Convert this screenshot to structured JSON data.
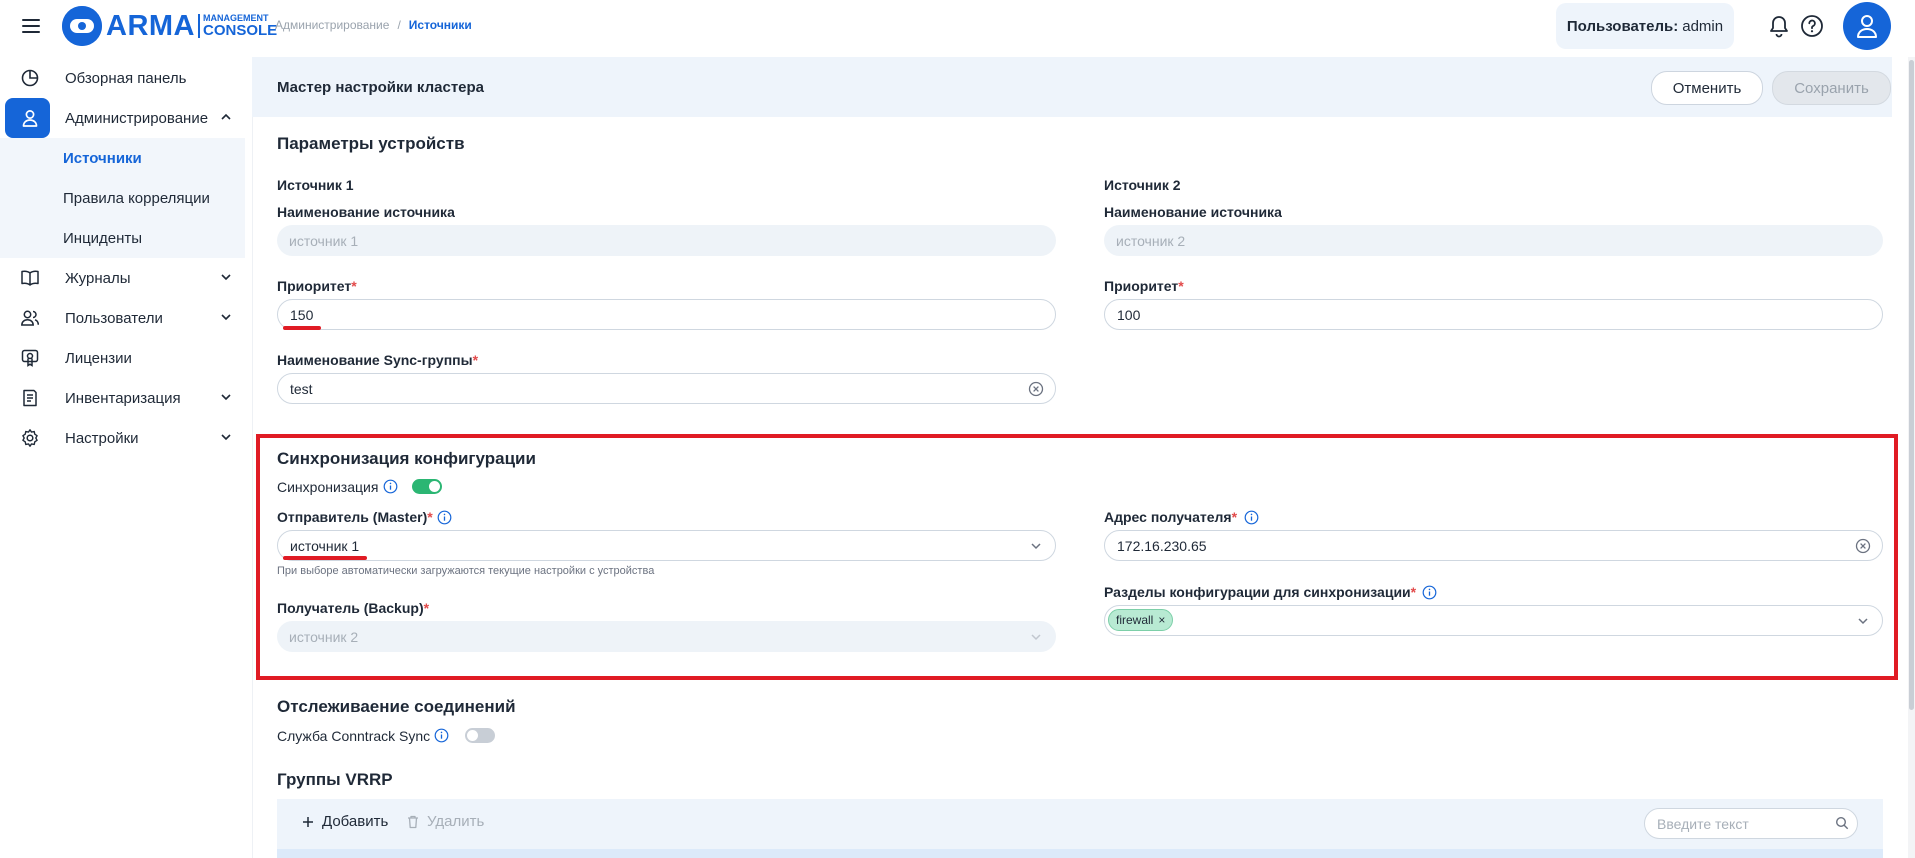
{
  "header": {
    "logo_text": "ARMA",
    "logo_sub1": "MANAGEMENT",
    "logo_sub2": "CONSOLE",
    "breadcrumb": [
      "Администрирование",
      "Источники"
    ],
    "user_label": "Пользователь:",
    "user_name": "admin"
  },
  "sidebar": {
    "items": [
      {
        "label": "Обзорная панель",
        "icon": "dashboard-icon"
      },
      {
        "label": "Администрирование",
        "icon": "user-icon",
        "expanded": true,
        "children": [
          "Источники",
          "Правила корреляции",
          "Инциденты"
        ]
      },
      {
        "label": "Журналы",
        "icon": "book-icon"
      },
      {
        "label": "Пользователи",
        "icon": "users-icon"
      },
      {
        "label": "Лицензии",
        "icon": "license-icon"
      },
      {
        "label": "Инвентаризация",
        "icon": "inventory-icon"
      },
      {
        "label": "Настройки",
        "icon": "gear-icon"
      }
    ]
  },
  "panel": {
    "title": "Мастер настройки кластера",
    "cancel": "Отменить",
    "save": "Сохранить"
  },
  "devices": {
    "heading": "Параметры устройств",
    "source1": {
      "title": "Источник 1",
      "name_label": "Наименование источника",
      "name_value": "источник 1",
      "priority_label": "Приоритет",
      "priority_value": "150",
      "sync_group_label": "Наименование Sync-группы",
      "sync_group_value": "test"
    },
    "source2": {
      "title": "Источник 2",
      "name_label": "Наименование источника",
      "name_value": "источник 2",
      "priority_label": "Приоритет",
      "priority_value": "100"
    }
  },
  "sync": {
    "heading": "Синхронизация конфигурации",
    "toggle_label": "Синхронизация",
    "toggle_on": true,
    "sender_label": "Отправитель (Master)",
    "sender_value": "источник 1",
    "sender_hint": "При выборе автоматически загружаются текущие настройки с устройства",
    "receiver_label": "Получатель (Backup)",
    "receiver_value": "источник 2",
    "address_label": "Адрес получателя",
    "address_value": "172.16.230.65",
    "sections_label": "Разделы конфигурации для синхронизации",
    "sections_tags": [
      "firewall"
    ]
  },
  "conntrack": {
    "heading": "Отслеживаение соединений",
    "toggle_label": "Служба Conntrack Sync",
    "toggle_on": false
  },
  "vrrp": {
    "heading": "Группы VRRP",
    "add": "Добавить",
    "delete": "Удалить",
    "search_placeholder": "Введите текст"
  },
  "colors": {
    "accent": "#1565d8",
    "highlight_red": "#e01b24",
    "toggle_green": "#2bb673",
    "tag_green": "#b8ead3"
  }
}
